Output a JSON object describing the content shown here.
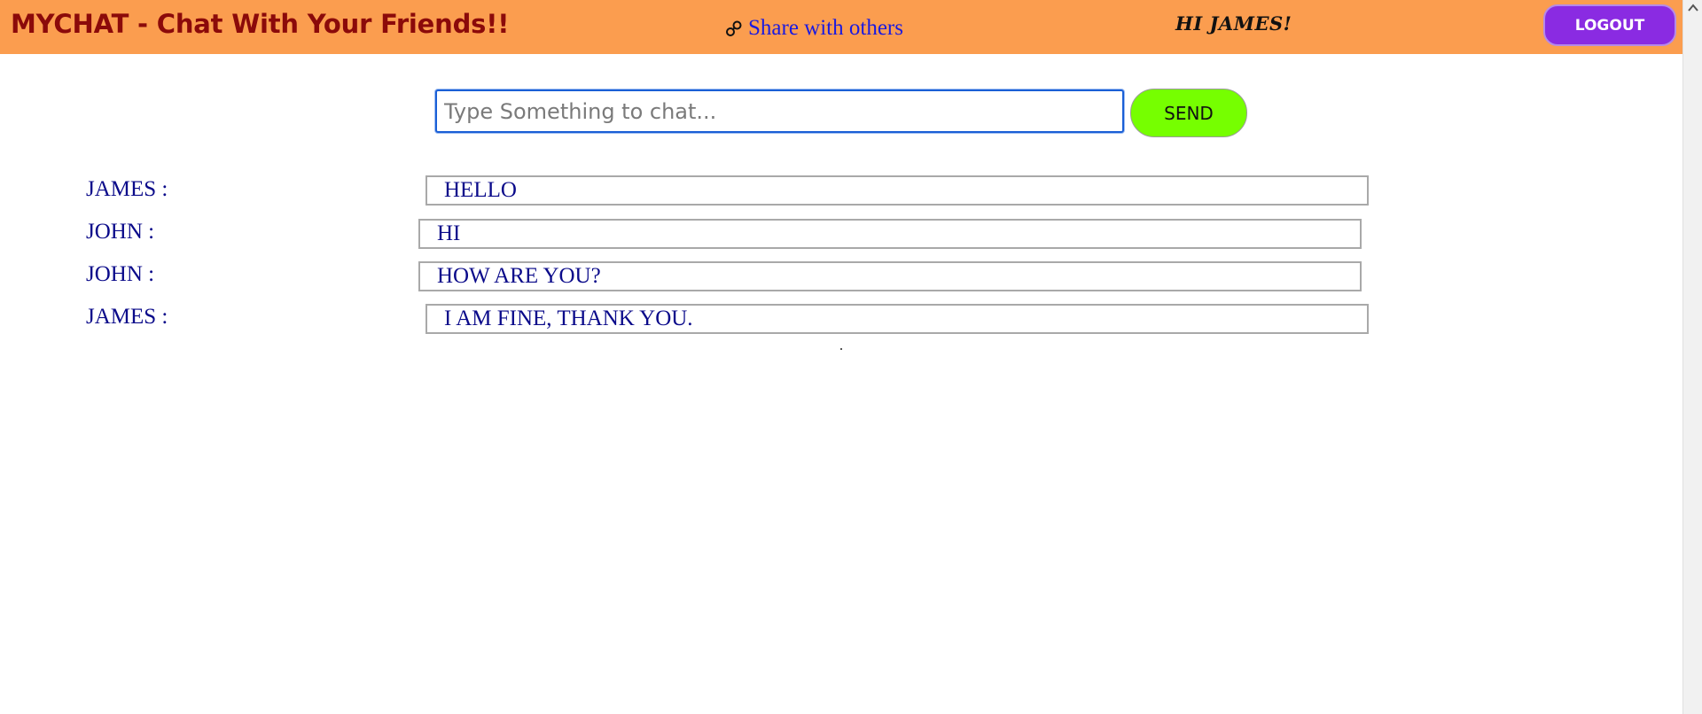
{
  "header": {
    "app_title": "MYCHAT - Chat With Your Friends!!",
    "share_label": "Share with others",
    "greeting": "HI JAMES!",
    "logout_label": "LOGOUT"
  },
  "composer": {
    "placeholder": "Type Something to chat...",
    "value": "",
    "send_label": "SEND"
  },
  "messages": [
    {
      "sender": "JAMES :",
      "text": "HELLO"
    },
    {
      "sender": "JOHN :",
      "text": "HI"
    },
    {
      "sender": "JOHN :",
      "text": "HOW ARE YOU?"
    },
    {
      "sender": "JAMES :",
      "text": "I AM FINE, THANK YOU."
    }
  ],
  "colors": {
    "header_bg": "#fb9d4f",
    "title": "#8b0a0a",
    "link": "#1a1ae0",
    "logout_bg": "#8a2be2",
    "send_bg": "#76ff00",
    "message_text": "#0a0a8a"
  },
  "icons": {
    "share": "link-icon",
    "scroll_up": "chevron-up-icon"
  }
}
